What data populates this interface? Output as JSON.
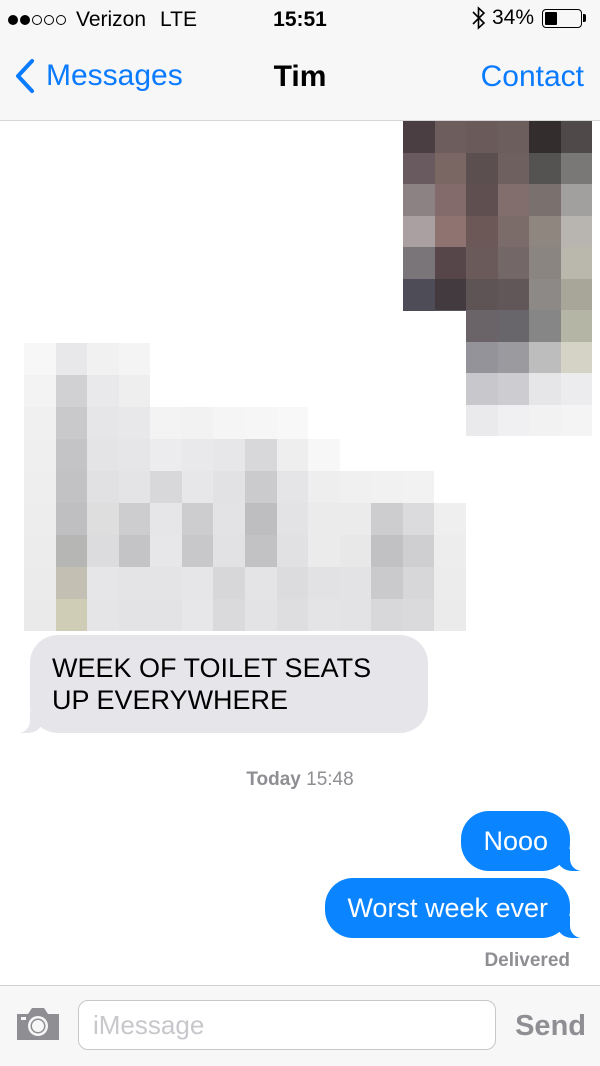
{
  "status_bar": {
    "signal_bars_filled": 2,
    "signal_bars_total": 5,
    "carrier": "Verizon",
    "network": "LTE",
    "time": "15:51",
    "bluetooth_icon": "bluetooth-icon",
    "battery_percent_label": "34%",
    "battery_level": 0.34
  },
  "nav": {
    "back_label": "Messages",
    "title": "Tim",
    "contact_label": "Contact"
  },
  "thread": {
    "attachments": [
      "pixelated-photo",
      "pixelated-screenshot"
    ],
    "incoming_message": "WEEK OF TOILET SEATS UP EVERYWHERE",
    "timestamp_day": "Today",
    "timestamp_time": "15:48",
    "outgoing_messages": [
      "Nooo",
      "Worst week ever"
    ],
    "delivery_status": "Delivered"
  },
  "input_bar": {
    "camera_icon": "camera-icon",
    "placeholder": "iMessage",
    "send_label": "Send"
  },
  "colors": {
    "accent_blue": "#0a7bff",
    "outgoing_bubble": "#0a84ff",
    "incoming_bubble": "#e5e5ea",
    "secondary_text": "#8e8e93"
  }
}
